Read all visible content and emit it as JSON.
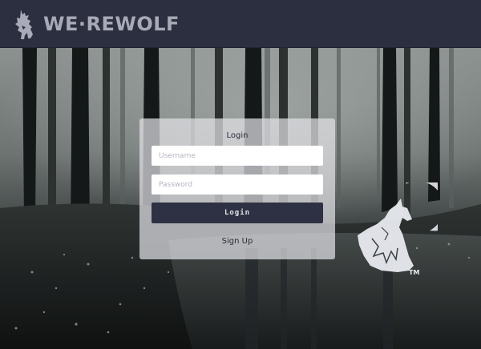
{
  "brand": {
    "name": "WE·REWOLF",
    "icon": "werewolf-icon"
  },
  "login": {
    "title": "Login",
    "username_placeholder": "Username",
    "password_placeholder": "Password",
    "login_label": "Login",
    "signup_label": "Sign Up"
  },
  "emblem": {
    "icon": "howling-wolf-moon-icon",
    "trademark": "TM"
  },
  "colors": {
    "header": "#2b2f40",
    "button": "#2d3143",
    "card": "#e1e1e4"
  }
}
